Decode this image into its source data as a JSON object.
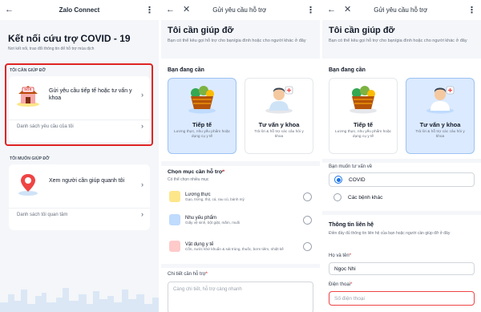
{
  "p1": {
    "header_title": "Zalo Connect",
    "page_title": "Kết nối cứu trợ COVID - 19",
    "page_subtitle": "Nơi kết nối, trao đổi thông tin để hỗ trợ mùa dịch",
    "need_help_caption": "TÔI CẦN GIÚP ĐỠ",
    "request_card_text": "Gửi yêu cầu tiếp tế hoặc tư vấn y khoa",
    "sos_label": "SOS",
    "my_requests_link": "Danh sách yêu cầu của tôi",
    "want_help_caption": "TÔI MUỐN GIÚP ĐỠ",
    "see_people_text": "Xem người cần giúp quanh tôi",
    "following_link": "Danh sách tôi quan tâm",
    "highlight_color": "#e02424"
  },
  "p2": {
    "header_title": "Gửi yêu cầu hỗ trợ",
    "form_title": "Tôi cần giúp đỡ",
    "form_subtitle": "Bạn có thể kêu gọi hỗ trợ cho bạn/gia đình hoặc cho người khác ở đây",
    "need_label": "Bạn đang cần",
    "supply_title": "Tiếp tế",
    "supply_desc": "Lương thực, nhu yếu phẩm hoặc dụng cụ y tế",
    "medical_title": "Tư vấn y khoa",
    "medical_desc": "Trả lời & hỗ trợ các câu hỏi y khoa",
    "choose_label": "Chọn mục cần hỗ trợ",
    "required_mark": "*",
    "choose_hint": "Có thể chọn nhiều mục",
    "items": [
      {
        "title": "Lương thực",
        "desc": "Gạo, trứng, thịt, cá, rau củ, bánh mỳ"
      },
      {
        "title": "Nhu yếu phẩm",
        "desc": "Giấy vệ sinh, bột giặt, mắm, muối"
      },
      {
        "title": "Vật dụng y tế",
        "desc": "Cồn, nước khử khuẩn & sát trùng, thuốc, bơm tiêm, nhiệt kế"
      }
    ],
    "detail_label": "Chi tiết cần hỗ trợ",
    "detail_placeholder": "Càng chi tiết, hỗ trợ càng nhanh"
  },
  "p3": {
    "header_title": "Gửi yêu cầu hỗ trợ",
    "form_title": "Tôi cần giúp đỡ",
    "form_subtitle": "Bạn có thể kêu gọi hỗ trợ cho bạn/gia đình hoặc cho người khác ở đây",
    "need_label": "Bạn đang cần",
    "supply_title": "Tiếp tế",
    "supply_desc": "Lương thực, nhu yếu phẩm hoặc dụng cụ y tế",
    "medical_title": "Tư vấn y khoa",
    "medical_desc": "Trả lời & hỗ trợ các câu hỏi y khoa",
    "consult_label": "Bạn muốn tư vấn về",
    "opt_covid": "COVID",
    "opt_other": "Các bệnh khác",
    "contact_title": "Thông tin liên hệ",
    "contact_desc": "Điền đầy đủ thông tin liên hệ của bạn hoặc người cần giúp đỡ ở đây",
    "name_label": "Họ và tên",
    "name_value": "Ngọc Nhi",
    "phone_label": "Điện thoại",
    "phone_placeholder": "Số điện thoại",
    "required_mark": "*"
  },
  "icons": {
    "back": "←",
    "close": "✕",
    "more": "⋮",
    "chevron": "›"
  },
  "colors": {
    "accent_blue": "#1a73e8",
    "selected_tile": "#dbeafe",
    "error_red": "#dc2626"
  }
}
